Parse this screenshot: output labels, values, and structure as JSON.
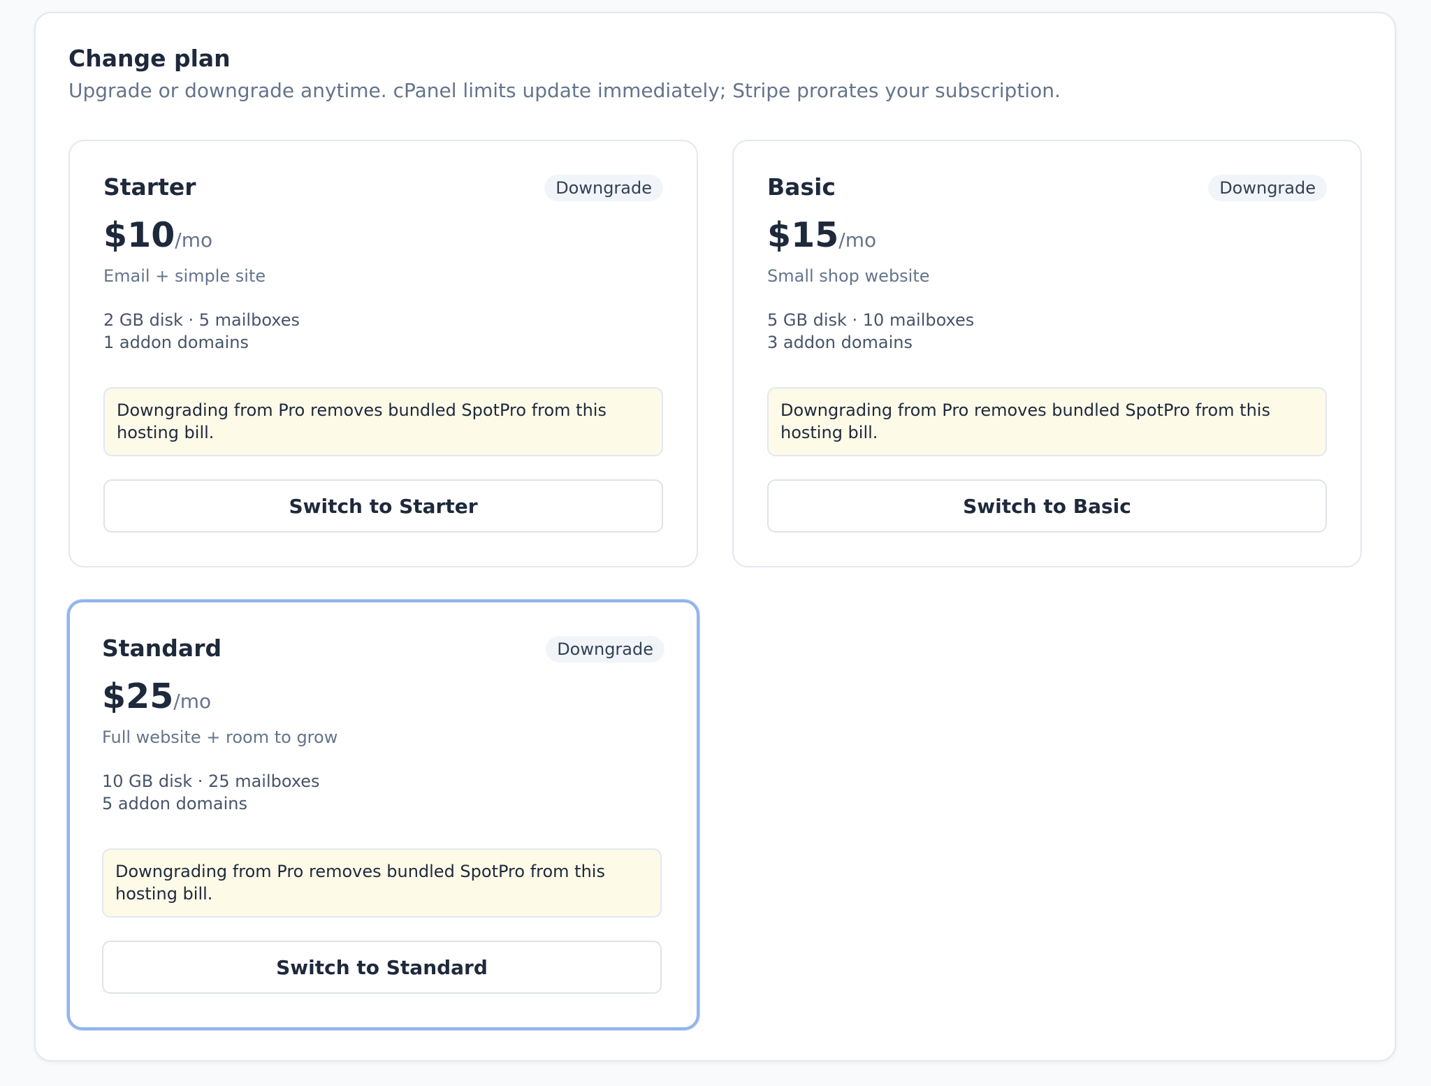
{
  "header": {
    "title": "Change plan",
    "subtitle": "Upgrade or downgrade anytime. cPanel limits update immediately; Stripe prorates your subscription."
  },
  "plans": [
    {
      "name": "Starter",
      "badge": "Downgrade",
      "price": "$10",
      "period": "/mo",
      "tagline": "Email + simple site",
      "spec_line1": "2 GB disk · 5 mailboxes",
      "spec_line2": "1 addon domains",
      "notice": "Downgrading from Pro removes bundled SpotPro from this hosting bill.",
      "button": "Switch to Starter"
    },
    {
      "name": "Basic",
      "badge": "Downgrade",
      "price": "$15",
      "period": "/mo",
      "tagline": "Small shop website",
      "spec_line1": "5 GB disk · 10 mailboxes",
      "spec_line2": "3 addon domains",
      "notice": "Downgrading from Pro removes bundled SpotPro from this hosting bill.",
      "button": "Switch to Basic"
    },
    {
      "name": "Standard",
      "badge": "Downgrade",
      "price": "$25",
      "period": "/mo",
      "tagline": "Full website + room to grow",
      "spec_line1": "10 GB disk · 25 mailboxes",
      "spec_line2": "5 addon domains",
      "notice": "Downgrading from Pro removes bundled SpotPro from this hosting bill.",
      "button": "Switch to Standard"
    }
  ],
  "colors": {
    "page_background": "#f8fafc",
    "notice_background": "#fefae8",
    "highlight_border": "#93b4ec",
    "text_primary": "#1e293b",
    "text_muted": "#64748b"
  }
}
